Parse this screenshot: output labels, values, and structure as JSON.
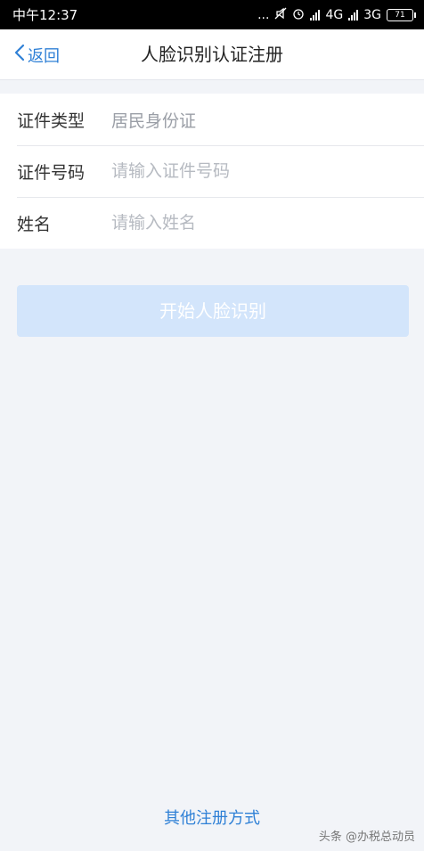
{
  "status_bar": {
    "time": "中午12:37",
    "dots": "...",
    "net_4g": "4G",
    "net_3g": "3G",
    "battery": "71"
  },
  "nav": {
    "back_label": "返回",
    "title": "人脸识别认证注册"
  },
  "form": {
    "rows": [
      {
        "label": "证件类型",
        "value": "居民身份证"
      },
      {
        "label": "证件号码",
        "placeholder": "请输入证件号码"
      },
      {
        "label": "姓名",
        "placeholder": "请输入姓名"
      }
    ]
  },
  "start_button_label": "开始人脸识别",
  "other_link_label": "其他注册方式",
  "watermark": "头条 @办税总动员",
  "colors": {
    "accent": "#2f80d6",
    "button_disabled_bg": "#d3e5fb",
    "page_bg": "#f2f4f8"
  }
}
